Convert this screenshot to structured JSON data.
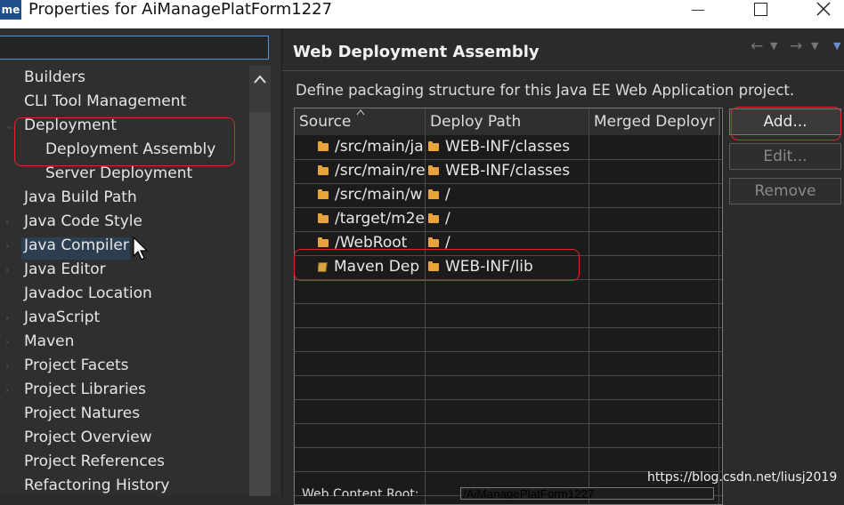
{
  "window": {
    "logo": "me",
    "title": "Properties for AiManagePlatForm1227"
  },
  "left_panel": {
    "filter_value": "",
    "tree": [
      {
        "label": "Builders",
        "level": 0,
        "expandable": false
      },
      {
        "label": "CLI Tool Management",
        "level": 0,
        "expandable": false
      },
      {
        "label": "Deployment",
        "level": 0,
        "expandable": true,
        "expanded": true
      },
      {
        "label": "Deployment Assembly",
        "level": 1,
        "expandable": false
      },
      {
        "label": "Server Deployment",
        "level": 1,
        "expandable": false
      },
      {
        "label": "Java Build Path",
        "level": 0,
        "expandable": false
      },
      {
        "label": "Java Code Style",
        "level": 0,
        "expandable": true
      },
      {
        "label": "Java Compiler",
        "level": 0,
        "expandable": true
      },
      {
        "label": "Java Editor",
        "level": 0,
        "expandable": true
      },
      {
        "label": "Javadoc Location",
        "level": 0,
        "expandable": false
      },
      {
        "label": "JavaScript",
        "level": 0,
        "expandable": true
      },
      {
        "label": "Maven",
        "level": 0,
        "expandable": true
      },
      {
        "label": "Project Facets",
        "level": 0,
        "expandable": true
      },
      {
        "label": "Project Libraries",
        "level": 0,
        "expandable": true
      },
      {
        "label": "Project Natures",
        "level": 0,
        "expandable": false
      },
      {
        "label": "Project Overview",
        "level": 0,
        "expandable": false
      },
      {
        "label": "Project References",
        "level": 0,
        "expandable": false
      },
      {
        "label": "Refactoring History",
        "level": 0,
        "expandable": false
      }
    ]
  },
  "right_panel": {
    "title": "Web Deployment Assembly",
    "description": "Define packaging structure for this Java EE Web Application project.",
    "columns": [
      "Source",
      "Deploy Path",
      "Merged Deployr"
    ],
    "rows": [
      {
        "source": "/src/main/ja",
        "deploy_path": "WEB-INF/classes",
        "icon": "folder-icon"
      },
      {
        "source": "/src/main/re",
        "deploy_path": "WEB-INF/classes",
        "icon": "folder-icon"
      },
      {
        "source": "/src/main/w",
        "deploy_path": "/",
        "icon": "folder-icon"
      },
      {
        "source": "/target/m2e",
        "deploy_path": "/",
        "icon": "folder-icon"
      },
      {
        "source": "/WebRoot",
        "deploy_path": "/",
        "icon": "folder-icon"
      },
      {
        "source": "Maven Dep",
        "deploy_path": "WEB-INF/lib",
        "icon": "library-icon"
      }
    ],
    "buttons": {
      "add": "Add...",
      "edit": "Edit...",
      "remove": "Remove"
    },
    "bottom_label": "Web Content Root:",
    "bottom_value": "/AiManagePlatForm1227"
  },
  "colors": {
    "annotation": "#e0262b",
    "folder": "#e8a33d",
    "selection": "#2c3e50"
  },
  "watermark": "https://blog.csdn.net/liusj2019"
}
